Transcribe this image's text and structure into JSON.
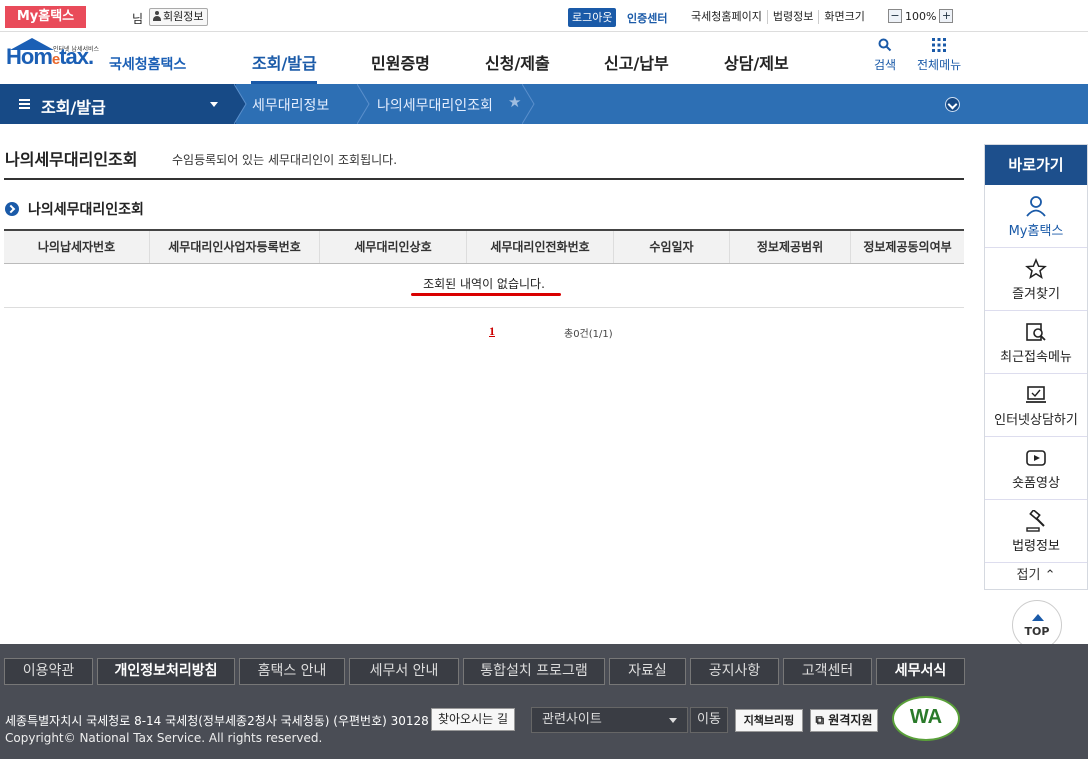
{
  "topbar": {
    "myhome": "My홈택스",
    "nim": "님",
    "member_info": "회원정보",
    "logout": "로그아웃",
    "cert_center": "인증센터",
    "links": [
      "국세청홈페이지",
      "법령정보",
      "화면크기"
    ],
    "zoom_minus": "−",
    "zoom_value": "100%",
    "zoom_plus": "+"
  },
  "logo": {
    "tagline": "인터넷 납세서비스",
    "hometax_a": "Hom",
    "hometax_e": "e",
    "hometax_b": "tax.",
    "korean": "국세청홈택스"
  },
  "gnb": {
    "menus": [
      "조회/발급",
      "민원증명",
      "신청/제출",
      "신고/납부",
      "상담/제보"
    ],
    "search": "검색",
    "all_menu": "전체메뉴"
  },
  "location": {
    "first": "조회/발급",
    "crumb1": "세무대리정보",
    "crumb2": "나의세무대리인조회"
  },
  "page": {
    "title": "나의세무대리인조회",
    "description": "수임등록되어 있는 세무대리인이 조회됩니다.",
    "section_title": "나의세무대리인조회"
  },
  "table": {
    "columns": [
      "나의납세자번호",
      "세무대리인사업자등록번호",
      "세무대리인상호",
      "세무대리인전화번호",
      "수임일자",
      "정보제공범위",
      "정보제공동의여부"
    ],
    "empty_message": "조회된 내역이 없습니다."
  },
  "pagination": {
    "page": "1",
    "total": "총0건(1/1)"
  },
  "sidebar": {
    "title": "바로가기",
    "items": [
      "My홈택스",
      "즐겨찾기",
      "최근접속메뉴",
      "인터넷상담하기",
      "숏폼영상",
      "법령정보"
    ],
    "fold": "접기"
  },
  "top_button": "TOP",
  "footer": {
    "nav": [
      "이용약관",
      "개인정보처리방침",
      "홈택스 안내",
      "세무서 안내",
      "통합설치 프로그램",
      "자료실",
      "공지사항",
      "고객센터",
      "세무서식"
    ],
    "address": "세종특별자치시 국세청로 8-14 국세청(정부세종2청사 국세청동) (우편번호) 30128",
    "find_way": "찾아오시는 길",
    "copyright": "Copyright© National Tax Service. All rights reserved.",
    "related_site": "관련사이트",
    "move": "이동",
    "jicheck": "지책브리핑",
    "remote": "원격지원",
    "wa_mark": "WA"
  },
  "colors": {
    "primary_blue": "#1a5aa8",
    "location_bar": "#2d6fb4",
    "location_dark": "#174a86",
    "myhome_red": "#e94b5a",
    "footer_bg": "#4a4d55",
    "highlight_red": "#d90000"
  }
}
